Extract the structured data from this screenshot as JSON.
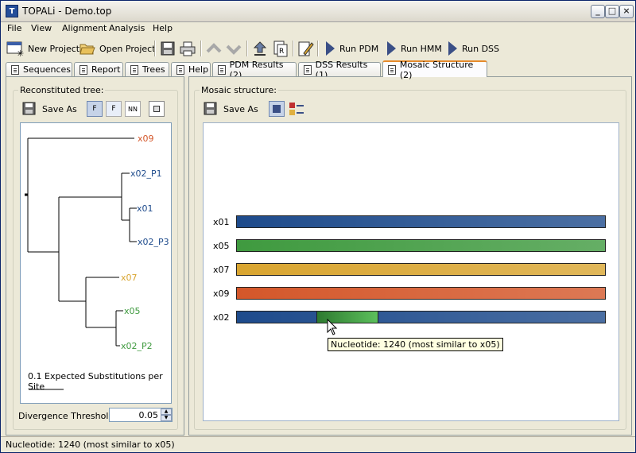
{
  "window": {
    "icon_letter": "T",
    "title": "TOPALi - Demo.top",
    "btn_min": "_",
    "btn_max": "□",
    "btn_close": "×"
  },
  "menu": [
    "File",
    "View",
    "Alignment",
    "Analysis",
    "Help"
  ],
  "toolbar": {
    "new_project": "New Project",
    "open_project": "Open Project",
    "run_pdm": "Run PDM",
    "run_hmm": "Run HMM",
    "run_dss": "Run DSS"
  },
  "tabs": [
    "Sequences",
    "Report",
    "Trees",
    "Help",
    "PDM Results (2)",
    "DSS Results (1)",
    "Mosaic Structure (2)"
  ],
  "left": {
    "group_label": "Reconstituted tree:",
    "save_as": "Save As",
    "tool_labels": [
      "F",
      "F",
      "NN"
    ],
    "leaves": [
      {
        "name": "x09",
        "color": "#d4572a"
      },
      {
        "name": "x02_P1",
        "color": "#1e4b8c"
      },
      {
        "name": "x01",
        "color": "#1e4b8c"
      },
      {
        "name": "x02_P3",
        "color": "#1e4b8c"
      },
      {
        "name": "x07",
        "color": "#d9a530"
      },
      {
        "name": "x05",
        "color": "#3f9a3f"
      },
      {
        "name": "x02_P2",
        "color": "#3f9a3f"
      }
    ],
    "scale_label": "0.1 Expected Substitutions per Site",
    "threshold_label": "Divergence Threshold:",
    "threshold_value": "0.05"
  },
  "right": {
    "group_label": "Mosaic structure:",
    "save_as": "Save As",
    "rows": [
      {
        "label": "x01",
        "color": "#1e4b8c"
      },
      {
        "label": "x05",
        "color": "#3f9a3f"
      },
      {
        "label": "x07",
        "color": "#d9a530"
      },
      {
        "label": "x09",
        "color": "#d4572a"
      },
      {
        "label": "x02",
        "color": "#1e4b8c"
      }
    ],
    "tooltip": "Nucleotide: 1240 (most similar to x05)"
  },
  "status": "Nucleotide: 1240 (most similar to x05)"
}
